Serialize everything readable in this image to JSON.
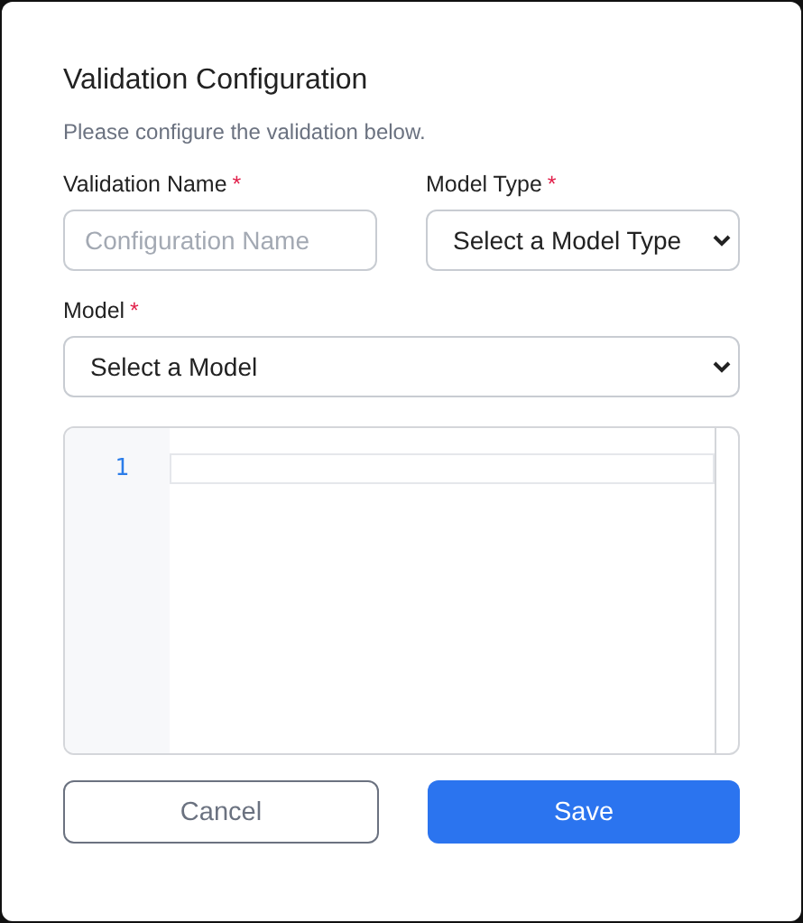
{
  "dialog": {
    "title": "Validation Configuration",
    "subtitle": "Please configure the validation below."
  },
  "field_rows": [
    [
      {
        "kind": "text",
        "label": "Validation Name",
        "required_mark": "*",
        "placeholder": "Configuration Name"
      },
      {
        "kind": "select",
        "label": "Model Type",
        "required_mark": "*",
        "value": "Select a Model Type"
      }
    ],
    [
      {
        "kind": "select",
        "label": "Model",
        "required_mark": "*",
        "value": "Select a Model"
      }
    ]
  ],
  "editor": {
    "lines": [
      {
        "number": "1",
        "active": true
      }
    ]
  },
  "buttons": [
    {
      "label": "Cancel",
      "kind": "secondary"
    },
    {
      "label": "Save",
      "kind": "primary"
    }
  ]
}
